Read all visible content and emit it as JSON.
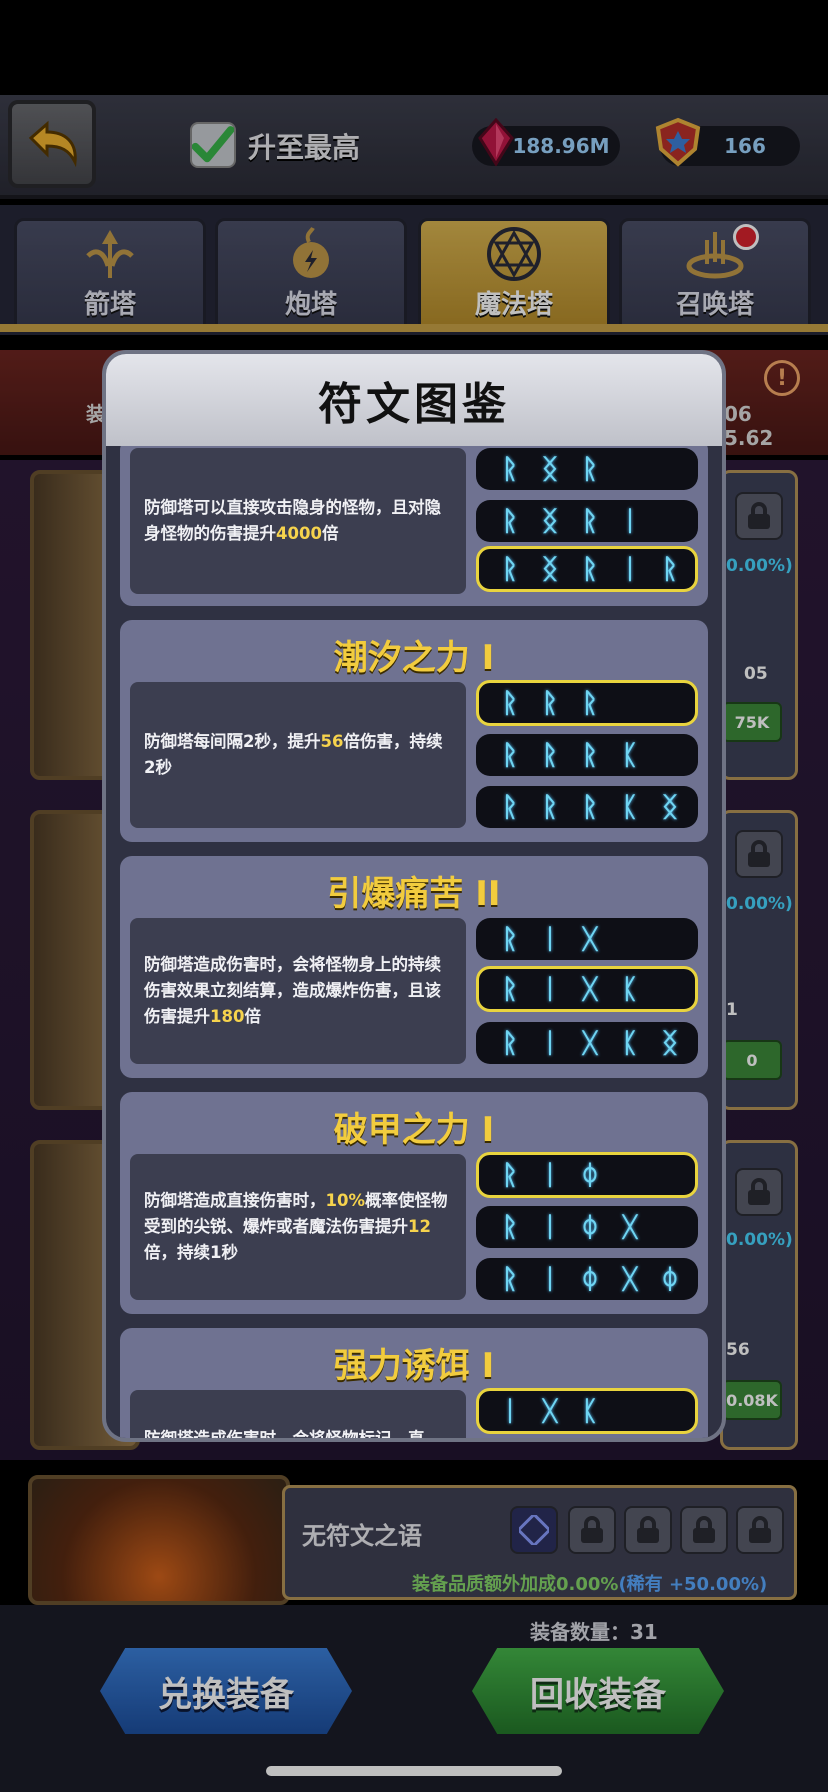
{
  "header": {
    "max_label": "升至最高",
    "gem_amount": "188.96M",
    "badge_amount": "166"
  },
  "tabs": [
    {
      "label": "箭塔",
      "active": false
    },
    {
      "label": "炮塔",
      "active": false
    },
    {
      "label": "魔法塔",
      "active": true
    },
    {
      "label": "召唤塔",
      "active": false,
      "notification": true
    }
  ],
  "background": {
    "band_left": "装",
    "band_right_1": "06",
    "band_right_2": "5.62",
    "stubs": [
      {
        "pct": "0.00%)",
        "num": "05",
        "btn": "75K"
      },
      {
        "pct": "0.00%)",
        "num": "1",
        "btn": "0"
      },
      {
        "pct": "0.00%)",
        "num": "56",
        "btn": "0.08K"
      }
    ],
    "bottom_item": {
      "title": "无符文之语",
      "quality_prefix": "装备品质额外加成0.00%",
      "quality_suffix": "(稀有 +50.00%)"
    },
    "equip_count": "装备数量：31"
  },
  "buttons": {
    "exchange": "兑换装备",
    "recycle": "回收装备"
  },
  "modal": {
    "title": "符文图鉴",
    "entries": [
      {
        "title": "",
        "desc_parts": [
          "防御塔可以直接攻击隐身的怪物，且对隐身怪物的伤害提升",
          "4000",
          "倍"
        ],
        "runes": [
          {
            "glyphs": [
              "ᚱ",
              "ᛝ",
              "ᚱ"
            ],
            "selected": false
          },
          {
            "glyphs": [
              "ᚱ",
              "ᛝ",
              "ᚱ",
              "ᛁ"
            ],
            "selected": false
          },
          {
            "glyphs": [
              "ᚱ",
              "ᛝ",
              "ᚱ",
              "ᛁ",
              "ᚱ"
            ],
            "selected": true
          }
        ]
      },
      {
        "title": "潮汐之力 I",
        "desc_parts": [
          "防御塔每间隔2秒，提升",
          "56",
          "倍伤害，持续2秒"
        ],
        "runes": [
          {
            "glyphs": [
              "ᚱ",
              "ᚱ",
              "ᚱ"
            ],
            "selected": true
          },
          {
            "glyphs": [
              "ᚱ",
              "ᚱ",
              "ᚱ",
              "ᛕ"
            ],
            "selected": false
          },
          {
            "glyphs": [
              "ᚱ",
              "ᚱ",
              "ᚱ",
              "ᛕ",
              "ᛝ"
            ],
            "selected": false
          }
        ]
      },
      {
        "title": "引爆痛苦 II",
        "desc_parts": [
          "防御塔造成伤害时，会将怪物身上的持续伤害效果立刻结算，造成爆炸伤害，且该伤害提升",
          "180",
          "倍"
        ],
        "runes": [
          {
            "glyphs": [
              "ᚱ",
              "ᛁ",
              "ᚷ"
            ],
            "selected": false
          },
          {
            "glyphs": [
              "ᚱ",
              "ᛁ",
              "ᚷ",
              "ᛕ"
            ],
            "selected": true
          },
          {
            "glyphs": [
              "ᚱ",
              "ᛁ",
              "ᚷ",
              "ᛕ",
              "ᛝ"
            ],
            "selected": false
          }
        ]
      },
      {
        "title": "破甲之力 I",
        "desc_parts": [
          "防御塔造成直接伤害时，",
          "10%",
          "概率使怪物受到的尖锐、爆炸或者魔法伤害提升",
          "12",
          "倍，持续1秒"
        ],
        "runes": [
          {
            "glyphs": [
              "ᚱ",
              "ᛁ",
              "ᛰ"
            ],
            "selected": true
          },
          {
            "glyphs": [
              "ᚱ",
              "ᛁ",
              "ᛰ",
              "ᚷ"
            ],
            "selected": false
          },
          {
            "glyphs": [
              "ᚱ",
              "ᛁ",
              "ᛰ",
              "ᚷ",
              "ᛰ"
            ],
            "selected": false
          }
        ]
      },
      {
        "title": "强力诱饵 I",
        "desc_parts": [
          "防御塔造成伤害时，会将怪物标记，直"
        ],
        "runes": [
          {
            "glyphs": [
              "ᛁ",
              "ᚷ",
              "ᛕ"
            ],
            "selected": true
          }
        ]
      }
    ]
  },
  "colors": {
    "rune_glyph": "#6fd5f2",
    "highlight": "#f6d34d",
    "entry_title": "#f2cc3e",
    "selected_border": "#e9d43e"
  },
  "icons": [
    "undo-arrow-icon",
    "checkmark-icon",
    "red-gem-icon",
    "shield-badge-icon",
    "arrow-tower-icon",
    "cannon-tower-icon",
    "magic-hexagram-icon",
    "summon-tower-icon",
    "lock-icon",
    "warning-icon"
  ]
}
